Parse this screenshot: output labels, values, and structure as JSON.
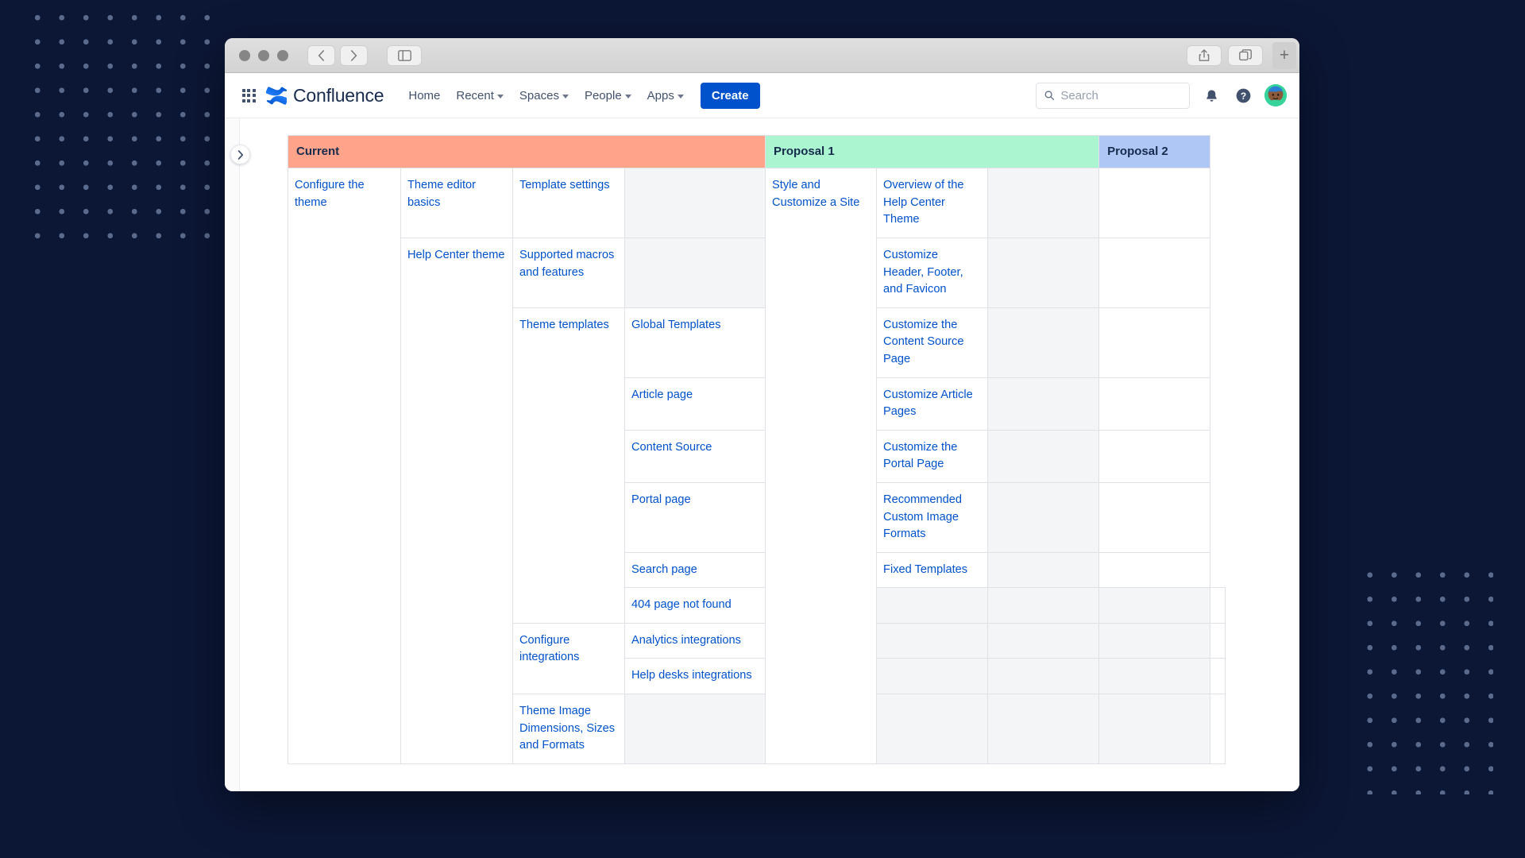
{
  "window": {
    "titlebar": {
      "back_icon": "chevron-left-icon",
      "forward_icon": "chevron-right-icon",
      "sidebar_icon": "sidebar-toggle-icon",
      "share_icon": "share-icon",
      "tabs_icon": "tab-overview-icon",
      "new_tab_label": "+"
    }
  },
  "nav": {
    "app_switcher_name": "app-switcher-icon",
    "brand": "Confluence",
    "links": [
      {
        "label": "Home",
        "has_caret": false
      },
      {
        "label": "Recent",
        "has_caret": true
      },
      {
        "label": "Spaces",
        "has_caret": true
      },
      {
        "label": "People",
        "has_caret": true
      },
      {
        "label": "Apps",
        "has_caret": true
      }
    ],
    "create_label": "Create",
    "search": {
      "value": "",
      "placeholder": "Search",
      "icon": "search-icon"
    },
    "notifications_icon": "bell-icon",
    "help_icon": "question-circle-icon",
    "avatar_name": "user-avatar"
  },
  "sidebar": {
    "toggle_icon": "chevron-right-icon"
  },
  "colors": {
    "header_current": "#ffa38b",
    "header_proposal1": "#abf5d1",
    "header_proposal2": "#aec7f5",
    "link": "#0052cc",
    "empty_cell": "#f4f5f7",
    "create_button": "#0052cc",
    "page_background": "#0c1736"
  },
  "table": {
    "headers": [
      {
        "label": "Current",
        "span": 4,
        "style": "h-current"
      },
      {
        "label": "Proposal 1",
        "span": 3,
        "style": "h-prop1"
      },
      {
        "label": "Proposal 2",
        "span": 1,
        "style": "h-prop2"
      }
    ],
    "rows": [
      {
        "cells": [
          {
            "text": "Configure the theme",
            "kind": "link",
            "rowspan": 11
          },
          {
            "text": "Theme editor basics",
            "kind": "link"
          },
          {
            "text": "Template settings",
            "kind": "link"
          },
          {
            "text": "",
            "kind": "empty"
          },
          {
            "text": "Style and Customize a Site",
            "kind": "link",
            "rowspan": 11
          },
          {
            "text": "Overview of the Help Center Theme",
            "kind": "link"
          },
          {
            "text": "",
            "kind": "empty"
          },
          {
            "text": "",
            "kind": "blank"
          }
        ]
      },
      {
        "cells": [
          {
            "text": "Help Center theme",
            "kind": "link",
            "rowspan": 10
          },
          {
            "text": "Supported macros and features",
            "kind": "link"
          },
          {
            "text": "",
            "kind": "empty"
          },
          {
            "text": "Customize Header, Footer, and Favicon",
            "kind": "link"
          },
          {
            "text": "",
            "kind": "empty"
          },
          {
            "text": "",
            "kind": "blank"
          }
        ]
      },
      {
        "cells": [
          {
            "text": "Theme templates",
            "kind": "link",
            "rowspan": 6
          },
          {
            "text": "Global Templates",
            "kind": "link"
          },
          {
            "text": "Customize the Content Source Page",
            "kind": "link"
          },
          {
            "text": "",
            "kind": "empty"
          },
          {
            "text": "",
            "kind": "blank"
          }
        ]
      },
      {
        "cells": [
          {
            "text": "Article page",
            "kind": "link"
          },
          {
            "text": "Customize Article Pages",
            "kind": "link"
          },
          {
            "text": "",
            "kind": "empty"
          },
          {
            "text": "",
            "kind": "blank"
          }
        ]
      },
      {
        "cells": [
          {
            "text": "Content Source",
            "kind": "link"
          },
          {
            "text": "Customize the Portal Page",
            "kind": "link"
          },
          {
            "text": "",
            "kind": "empty"
          },
          {
            "text": "",
            "kind": "blank"
          }
        ]
      },
      {
        "cells": [
          {
            "text": "Portal page",
            "kind": "link"
          },
          {
            "text": "Recommended Custom Image Formats",
            "kind": "link"
          },
          {
            "text": "",
            "kind": "empty"
          },
          {
            "text": "",
            "kind": "blank"
          }
        ]
      },
      {
        "cells": [
          {
            "text": "Search page",
            "kind": "link"
          },
          {
            "text": "Fixed Templates",
            "kind": "link"
          },
          {
            "text": "",
            "kind": "empty"
          },
          {
            "text": "",
            "kind": "blank"
          }
        ]
      },
      {
        "cells": [
          {
            "text": "404 page not found",
            "kind": "link"
          },
          {
            "text": "",
            "kind": "empty"
          },
          {
            "text": "",
            "kind": "empty"
          },
          {
            "text": "",
            "kind": "empty"
          },
          {
            "text": "",
            "kind": "blank"
          }
        ]
      },
      {
        "cells": [
          {
            "text": "Configure integrations",
            "kind": "link",
            "rowspan": 2
          },
          {
            "text": "Analytics integrations",
            "kind": "link"
          },
          {
            "text": "",
            "kind": "empty"
          },
          {
            "text": "",
            "kind": "empty"
          },
          {
            "text": "",
            "kind": "empty"
          },
          {
            "text": "",
            "kind": "blank"
          }
        ]
      },
      {
        "cells": [
          {
            "text": "Help desks integrations",
            "kind": "link"
          },
          {
            "text": "",
            "kind": "empty"
          },
          {
            "text": "",
            "kind": "empty"
          },
          {
            "text": "",
            "kind": "empty"
          },
          {
            "text": "",
            "kind": "blank"
          }
        ]
      },
      {
        "cells": [
          {
            "text": "Theme Image Dimensions, Sizes and Formats",
            "kind": "link"
          },
          {
            "text": "",
            "kind": "empty"
          },
          {
            "text": "",
            "kind": "empty"
          },
          {
            "text": "",
            "kind": "empty"
          },
          {
            "text": "",
            "kind": "empty"
          },
          {
            "text": "",
            "kind": "blank"
          }
        ]
      }
    ]
  }
}
